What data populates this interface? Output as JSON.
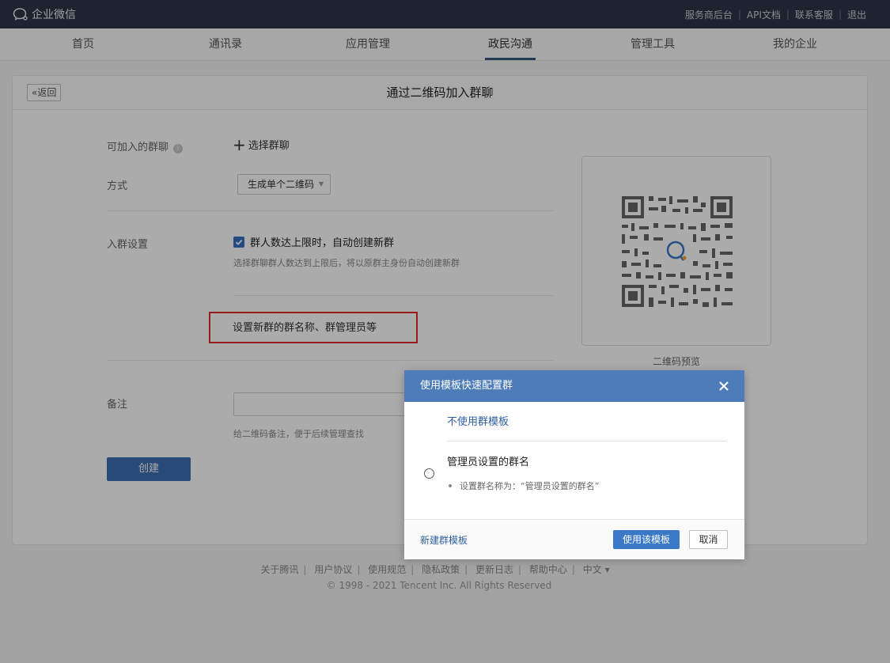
{
  "topbar": {
    "brand": "企业微信",
    "links": [
      "服务商后台",
      "API文档",
      "联系客服",
      "退出"
    ]
  },
  "nav": {
    "items": [
      "首页",
      "通讯录",
      "应用管理",
      "政民沟通",
      "管理工具",
      "我的企业"
    ],
    "active": "政民沟通"
  },
  "page": {
    "back": "返回",
    "title": "通过二维码加入群聊",
    "joinable_label": "可加入的群聊",
    "select_group": "选择群聊",
    "method_label": "方式",
    "method_value": "生成单个二维码",
    "join_settings_label": "入群设置",
    "auto_create_label": "群人数达上限时，自动创建新群",
    "auto_create_checked": true,
    "auto_create_hint": "选择群聊群人数达到上限后，将以原群主身份自动创建新群",
    "set_template": "设置新群的群名称、群管理员等",
    "note_label": "备注",
    "note_value": "",
    "note_hint": "给二维码备注，便于后续管理查找",
    "create_button": "创建",
    "qr_caption": "二维码预览"
  },
  "footer": {
    "links": [
      "关于腾讯",
      "用户协议",
      "使用规范",
      "隐私政策",
      "更新日志",
      "帮助中心",
      "中文 ▾"
    ],
    "copyright": "© 1998 - 2021 Tencent Inc. All Rights Reserved"
  },
  "dialog": {
    "title": "使用模板快速配置群",
    "no_template": "不使用群模板",
    "option_title": "管理员设置的群名",
    "option_desc": "设置群名称为：“管理员设置的群名”",
    "new_template": "新建群模板",
    "use_button": "使用该模板",
    "cancel_button": "取消"
  },
  "colors": {
    "topbar": "#2c3748",
    "accent": "#3a78c8",
    "dialog_header": "#4d7cb8",
    "highlight_box": "#e02a2a"
  }
}
